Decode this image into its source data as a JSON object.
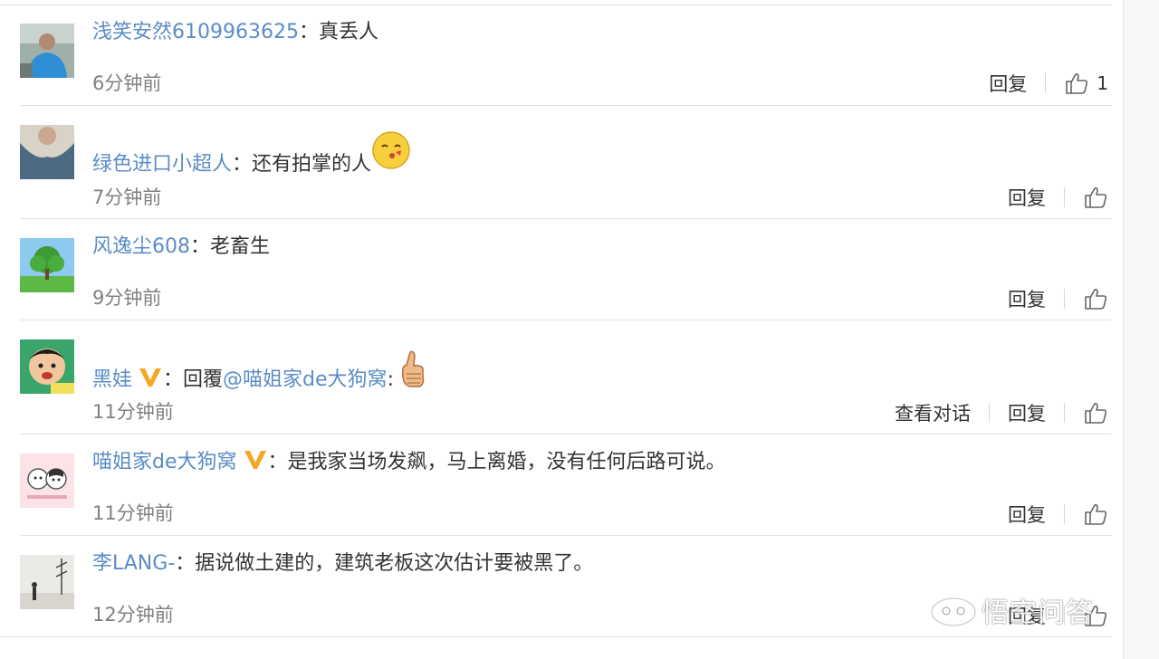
{
  "comments": [
    {
      "user": "浅笑安然6109963625",
      "colon": "：",
      "text": "真丢人",
      "time": "6分钟前",
      "reply": "回复",
      "likes": "1"
    },
    {
      "user": "绿色进口小超人",
      "colon": "：",
      "text": "还有拍掌的人",
      "time": "7分钟前",
      "reply": "回复"
    },
    {
      "user": "风逸尘608",
      "colon": "：",
      "text": "老畜生",
      "time": "9分钟前",
      "reply": "回复"
    },
    {
      "user": "黑娃",
      "colon": "：",
      "prefix": "回覆",
      "mention": "@喵姐家de大狗窝",
      "mention_colon": ":",
      "time": "11分钟前",
      "view_conversation": "查看对话",
      "reply": "回复"
    },
    {
      "user": "喵姐家de大狗窝",
      "colon": "：",
      "text": "是我家当场发飙，马上离婚，没有任何后路可说。",
      "time": "11分钟前",
      "reply": "回复"
    },
    {
      "user": "李LANG-",
      "colon": "：",
      "text": "据说做土建的，建筑老板这次估计要被黑了。",
      "time": "12分钟前",
      "reply": "回复"
    }
  ],
  "watermark": "悟空问答",
  "colors": {
    "link": "#5b8cc6",
    "text": "#333333",
    "muted": "#808080",
    "separator": "#e1e1e1",
    "vip_badge": "#f5a623"
  },
  "icons": {
    "like": "thumbs-up-outline-icon",
    "vip": "v-badge-icon"
  }
}
